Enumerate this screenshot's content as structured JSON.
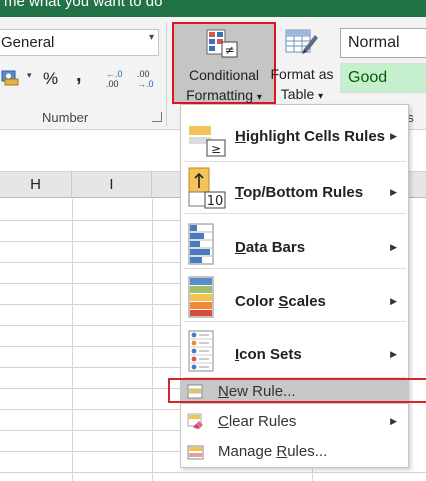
{
  "title_bar": {
    "text": "me what you want to do"
  },
  "ribbon": {
    "number_format": {
      "value": "General"
    },
    "number_group": {
      "percent_label": "%",
      "comma_label": ",",
      "increase_decimal_top": "←.0",
      "increase_decimal_bottom": ".00",
      "decrease_decimal_top": ".00",
      "decrease_decimal_bottom": "→.0",
      "group_label": "Number"
    },
    "conditional_formatting": {
      "line1": "Conditional",
      "line2": "Formatting",
      "dropdown": "▾"
    },
    "format_as_table": {
      "line1": "Format as",
      "line2": "Table",
      "dropdown": "▾"
    },
    "styles": {
      "normal": "Normal",
      "good": "Good",
      "group_label_fragment": "es"
    }
  },
  "grid": {
    "columns": [
      "H",
      "I"
    ]
  },
  "menu": {
    "big_items": [
      {
        "label": "Highlight Cells Rules",
        "mnemonic": "H",
        "rest": "ighlight Cells Rules",
        "icon": "highlight-cells-icon",
        "submenu": true
      },
      {
        "label": "Top/Bottom Rules",
        "mnemonic": "T",
        "rest": "op/Bottom Rules",
        "icon": "top-bottom-icon",
        "submenu": true
      },
      {
        "label": "Data Bars",
        "mnemonic": "D",
        "rest": "ata Bars",
        "icon": "data-bars-icon",
        "submenu": true
      },
      {
        "label": "Color Scales",
        "mnemonic": "S",
        "pre": "Color ",
        "rest": "cales",
        "icon": "color-scales-icon",
        "submenu": true
      },
      {
        "label": "Icon Sets",
        "mnemonic": "I",
        "rest": "con Sets",
        "icon": "icon-sets-icon",
        "submenu": true
      }
    ],
    "small_items": [
      {
        "label": "New Rule...",
        "mnemonic": "N",
        "rest": "ew Rule...",
        "icon": "new-rule-icon",
        "submenu": false,
        "highlighted": true
      },
      {
        "label": "Clear Rules",
        "mnemonic": "C",
        "rest": "lear Rules",
        "icon": "clear-rules-icon",
        "submenu": true,
        "highlighted": false
      },
      {
        "label": "Manage Rules...",
        "pre": "Manage ",
        "mnemonic": "R",
        "rest": "ules...",
        "icon": "manage-rules-icon",
        "submenu": false,
        "highlighted": false
      }
    ],
    "submenu_arrow": "▶"
  },
  "colors": {
    "excel_green": "#217346",
    "highlight_outline": "#e0161c",
    "good_fill": "#c6efce",
    "good_text": "#006100",
    "menu_hover": "#c7c7c7"
  }
}
